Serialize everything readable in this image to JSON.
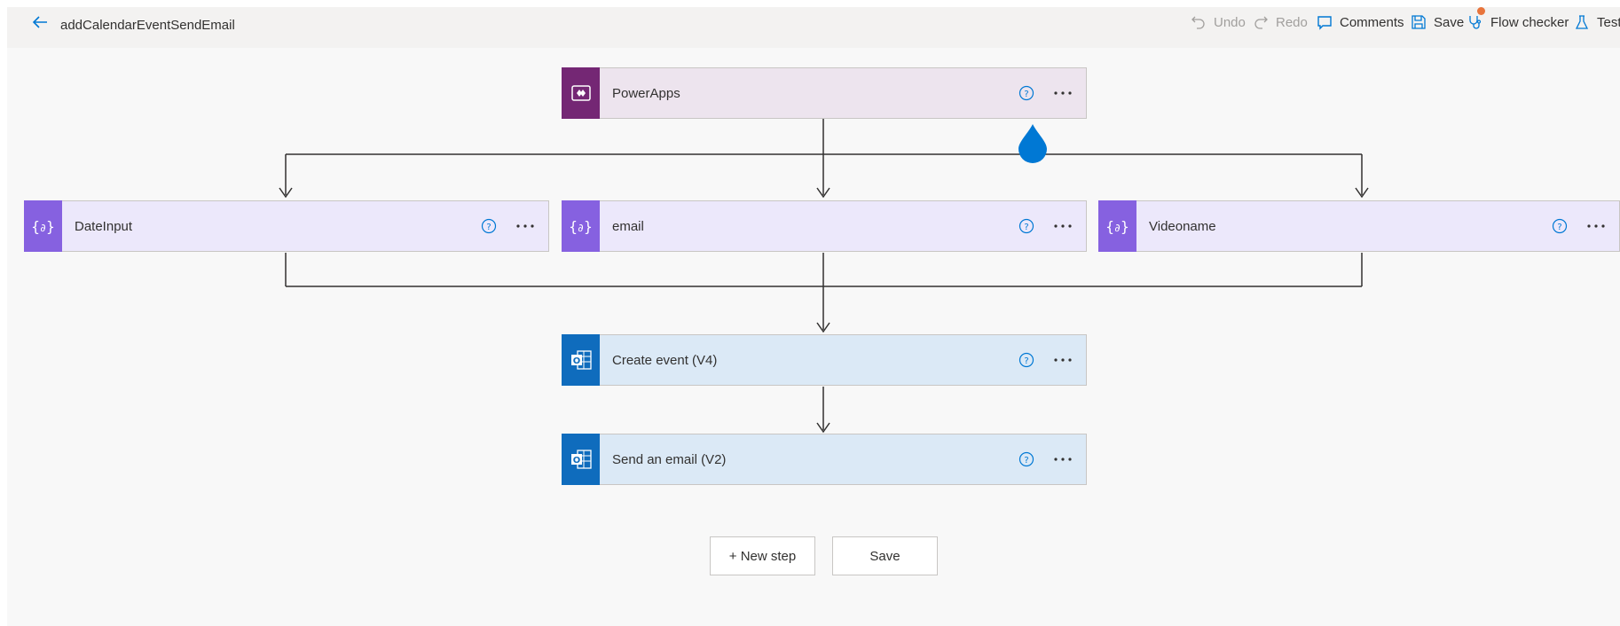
{
  "header": {
    "title": "addCalendarEventSendEmail",
    "undo_label": "Undo",
    "redo_label": "Redo",
    "comments_label": "Comments",
    "save_label": "Save",
    "flow_checker_label": "Flow checker",
    "test_label": "Test"
  },
  "flow": {
    "trigger": {
      "label": "PowerApps",
      "icon": "powerapps-icon"
    },
    "branches": [
      {
        "label": "DateInput",
        "icon": "variable-icon"
      },
      {
        "label": "email",
        "icon": "variable-icon"
      },
      {
        "label": "Videoname",
        "icon": "variable-icon"
      }
    ],
    "steps": [
      {
        "label": "Create event (V4)",
        "icon": "outlook-icon"
      },
      {
        "label": "Send an email (V2)",
        "icon": "outlook-icon"
      }
    ]
  },
  "footer": {
    "new_step_label": "+ New step",
    "save_label": "Save"
  },
  "colors": {
    "accent": "#0078d4",
    "powerapps": "#742774",
    "variable": "#8661e0",
    "outlook": "#0f6cbd",
    "flow_checker_badge": "#e8743b"
  }
}
